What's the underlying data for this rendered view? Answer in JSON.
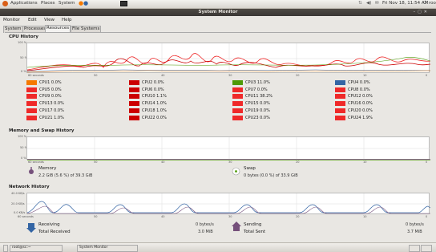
{
  "top_panel": {
    "menus": [
      "Applications",
      "Places",
      "System"
    ],
    "datetime": "Fri Nov 18, 11:54 AM",
    "user": "root"
  },
  "window": {
    "title": "System Monitor"
  },
  "menubar": [
    "Monitor",
    "Edit",
    "View",
    "Help"
  ],
  "tabs": [
    "System",
    "Processes",
    "Resources",
    "File Systems"
  ],
  "active_tab": "Resources",
  "cpu_history": {
    "heading": "CPU History",
    "y_ticks": [
      "100 %",
      "50 %",
      "0 %"
    ],
    "x_ticks": [
      "60 seconds",
      "50",
      "40",
      "30",
      "20",
      "10",
      "0"
    ],
    "cpus": [
      {
        "label": "CPU1 0.0%",
        "color": "#f57900"
      },
      {
        "label": "CPU2 0.0%",
        "color": "#cc0000"
      },
      {
        "label": "CPU3 11.0%",
        "color": "#4e9a06"
      },
      {
        "label": "CPU4 0.0%",
        "color": "#3465a4"
      },
      {
        "label": "CPU5 0.0%",
        "color": "#ef2929"
      },
      {
        "label": "CPU6 0.0%",
        "color": "#cc0000"
      },
      {
        "label": "CPU7 0.0%",
        "color": "#ef2929"
      },
      {
        "label": "CPU8 0.0%",
        "color": "#ef2929"
      },
      {
        "label": "CPU9 0.0%",
        "color": "#ef2929"
      },
      {
        "label": "CPU10 1.1%",
        "color": "#cc0000"
      },
      {
        "label": "CPU11 38.2%",
        "color": "#ef2929"
      },
      {
        "label": "CPU12 0.0%",
        "color": "#ef2929"
      },
      {
        "label": "CPU13 0.0%",
        "color": "#ef2929"
      },
      {
        "label": "CPU14 1.0%",
        "color": "#cc0000"
      },
      {
        "label": "CPU15 0.0%",
        "color": "#ef2929"
      },
      {
        "label": "CPU16 0.0%",
        "color": "#ef2929"
      },
      {
        "label": "CPU17 0.0%",
        "color": "#ef2929"
      },
      {
        "label": "CPU18 1.0%",
        "color": "#cc0000"
      },
      {
        "label": "CPU19 0.0%",
        "color": "#ef2929"
      },
      {
        "label": "CPU20 0.0%",
        "color": "#ef2929"
      },
      {
        "label": "CPU21 1.0%",
        "color": "#ef2929"
      },
      {
        "label": "CPU22 0.0%",
        "color": "#cc0000"
      },
      {
        "label": "CPU23 0.0%",
        "color": "#ef2929"
      },
      {
        "label": "CPU24 1.9%",
        "color": "#ef2929"
      }
    ]
  },
  "memory": {
    "heading": "Memory and Swap History",
    "y_ticks": [
      "100 %",
      "50 %",
      "0 %"
    ],
    "x_ticks": [
      "60 seconds",
      "50",
      "40",
      "30",
      "20",
      "10",
      "0"
    ],
    "memory_label": "Memory",
    "memory_value": "2.2 GiB (5.6 %) of 39.3 GiB",
    "swap_label": "Swap",
    "swap_value": "0 bytes (0.0 %) of 33.9 GiB"
  },
  "network": {
    "heading": "Network History",
    "y_ticks": [
      "40.0 KB/s",
      "20.0 KB/s",
      "0.0 KB/s"
    ],
    "x_ticks": [
      "60 seconds",
      "50",
      "40",
      "30",
      "20",
      "10",
      "0"
    ],
    "receiving_label": "Receiving",
    "receiving_rate": "0 bytes/s",
    "total_received_label": "Total Received",
    "total_received": "3.0 MiB",
    "sending_label": "Sending",
    "sending_rate": "0 bytes/s",
    "total_sent_label": "Total Sent",
    "total_sent": "3.7 MiB"
  },
  "taskbar": {
    "items": [
      "root@sc:~",
      "System Monitor"
    ]
  },
  "colors": {
    "received": "#3465a4",
    "sent": "#75507b"
  }
}
